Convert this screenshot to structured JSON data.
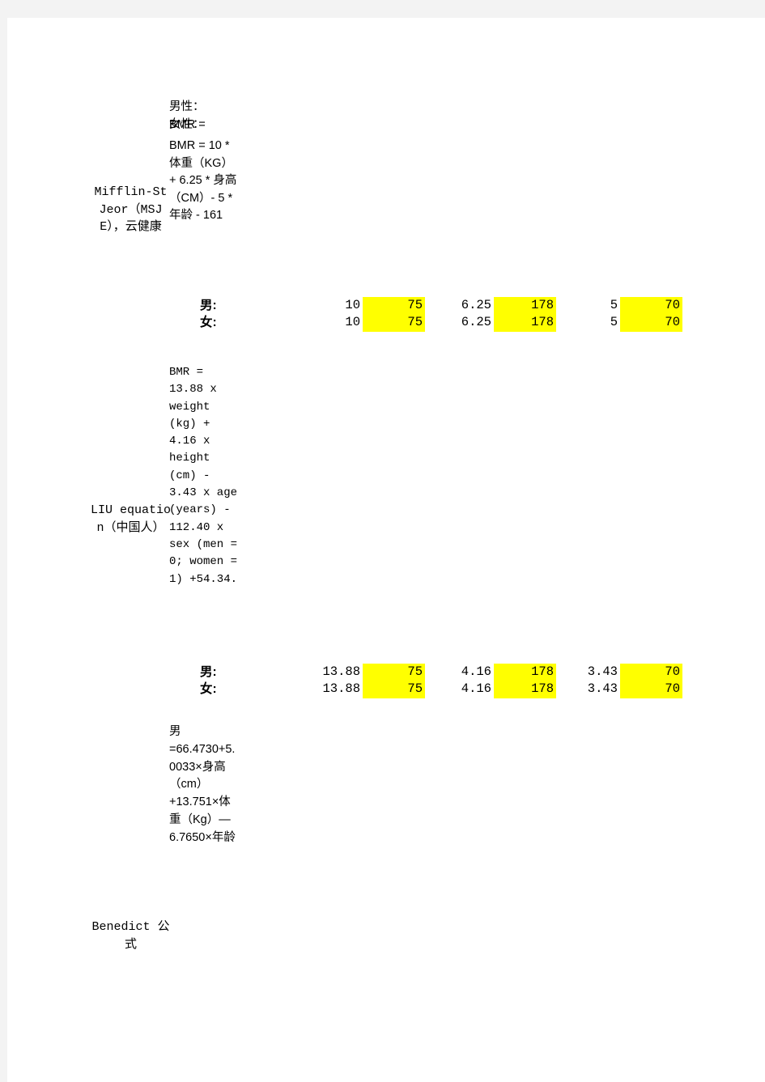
{
  "page": {
    "background_color": "#f3f3f3",
    "sheet_color": "#ffffff",
    "highlight_color": "#ffff00"
  },
  "methods": [
    {
      "id": "msje",
      "name_label": "Mifflin-St Jeor（MSJE），云健康",
      "formula_lines": {
        "male_heading": "男性：",
        "female_heading": "女性：",
        "overlap_bmr": "BMR =",
        "body": "BMR = 10 * 体重（KG）+ 6.25 * 身高（CM）- 5 * 年龄 - 161"
      },
      "rows": [
        {
          "sex": "男:",
          "coef_weight": "10",
          "weight": "75",
          "coef_height": "6.25",
          "height": "178",
          "coef_age": "5",
          "age": "70"
        },
        {
          "sex": "女:",
          "coef_weight": "10",
          "weight": "75",
          "coef_height": "6.25",
          "height": "178",
          "coef_age": "5",
          "age": "70"
        }
      ]
    },
    {
      "id": "liu",
      "name_label": "LIU equation（中国人）",
      "formula_text": "BMR = 13.88 x weight (kg) + 4.16 x height (cm) - 3.43 x age (years) - 112.40 x sex (men = 0; women = 1) +54.34.",
      "rows": [
        {
          "sex": "男:",
          "coef_weight": "13.88",
          "weight": "75",
          "coef_height": "4.16",
          "height": "178",
          "coef_age": "3.43",
          "age": "70"
        },
        {
          "sex": "女:",
          "coef_weight": "13.88",
          "weight": "75",
          "coef_height": "4.16",
          "height": "178",
          "coef_age": "3.43",
          "age": "70"
        }
      ]
    },
    {
      "id": "benedict",
      "name_label": "Benedict 公式",
      "formula_text": "男 =66.4730+5.0033×身高（cm）+13.751×体重（Kg）—6.7650×年龄"
    }
  ]
}
